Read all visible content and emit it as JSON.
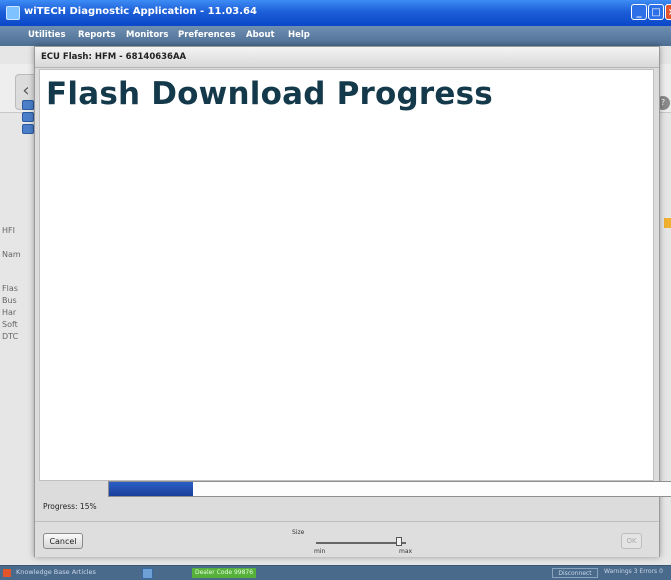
{
  "window": {
    "title": "wiTECH Diagnostic Application - 11.03.64"
  },
  "menu": [
    "Utilities",
    "Reports",
    "Monitors",
    "Preferences",
    "About",
    "Help"
  ],
  "background": {
    "labels": [
      "HFI",
      "Nam",
      "Flas",
      "Bus",
      "Har",
      "Soft",
      "DTC"
    ]
  },
  "dialog": {
    "title": "ECU Flash: HFM - 68140636AA",
    "heading": "Flash Download Progress",
    "progress": {
      "label": "Progress: 15%",
      "value": 0.15
    },
    "size_label": "Size",
    "size_min": "min",
    "size_max": "max",
    "size_level": 0.92,
    "cancel_label": "Cancel",
    "ok_label": "OK"
  },
  "statusbar": {
    "kb_label": "Knowledge Base Articles",
    "dealer_code": "Dealer Code 99876",
    "disconnect_label": "Disconnect",
    "warnings": "Warnings 3 Errors 0"
  }
}
